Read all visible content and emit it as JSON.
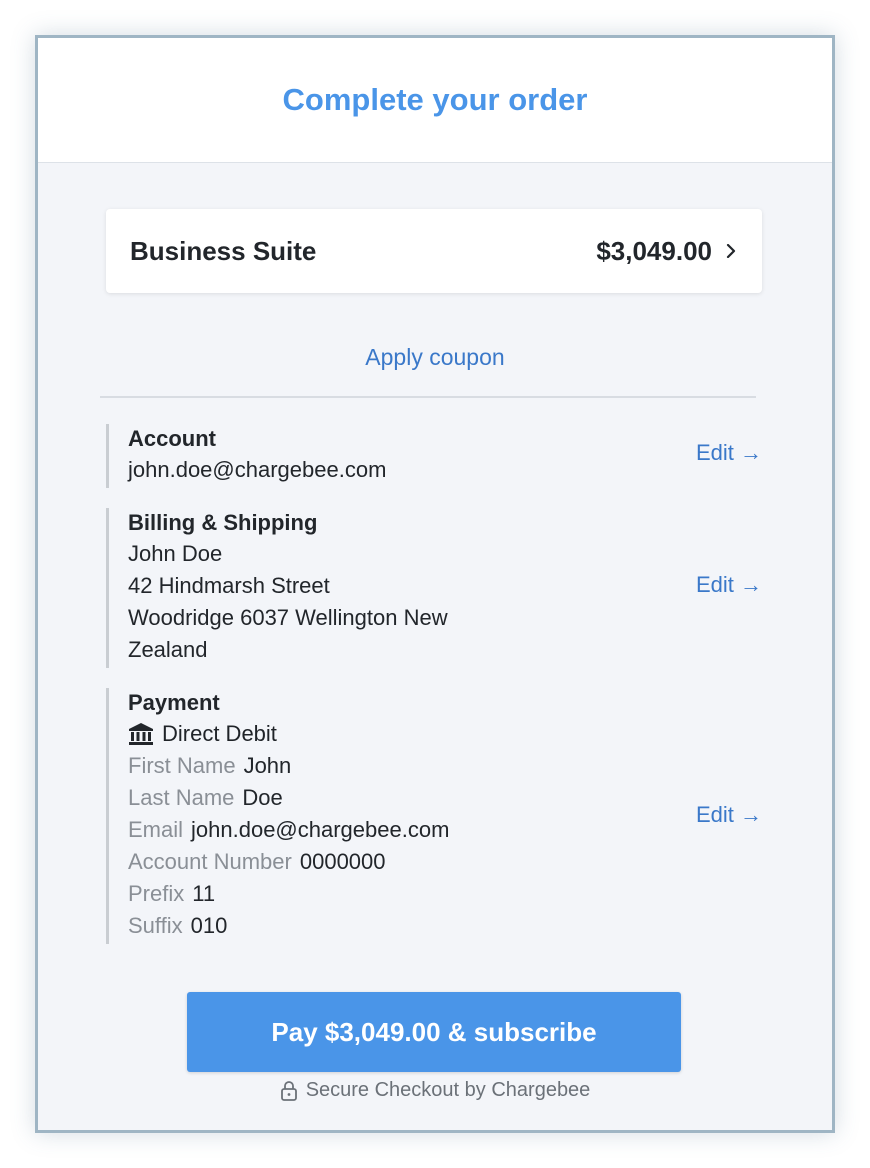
{
  "header": {
    "title": "Complete your order"
  },
  "product": {
    "name": "Business Suite",
    "price": "$3,049.00",
    "icon": "chevron-right-icon"
  },
  "coupon": {
    "label": "Apply coupon"
  },
  "account": {
    "title": "Account",
    "email": "john.doe@chargebee.com",
    "edit_label": "Edit →"
  },
  "billing": {
    "title": "Billing & Shipping",
    "lines": [
      "John Doe",
      "42 Hindmarsh Street",
      "Woodridge 6037 Wellington New",
      "Zealand"
    ],
    "edit_label": "Edit →"
  },
  "payment": {
    "title": "Payment",
    "method": "Direct Debit",
    "method_icon": "bank-icon",
    "fields": [
      {
        "label": "First Name",
        "value": "John"
      },
      {
        "label": "Last Name",
        "value": "Doe"
      },
      {
        "label": "Email",
        "value": "john.doe@chargebee.com"
      },
      {
        "label": "Account Number",
        "value": "0000000"
      },
      {
        "label": "Prefix",
        "value": "11"
      },
      {
        "label": "Suffix",
        "value": "010"
      }
    ],
    "edit_label": "Edit →"
  },
  "pay_button": {
    "label": "Pay $3,049.00 & subscribe"
  },
  "footer": {
    "secure_text": "Secure Checkout by Chargebee",
    "icon": "lock-icon"
  },
  "colors": {
    "accent": "#4a95e8",
    "link": "#3a78c9",
    "background": "#f3f5f9",
    "frame_border": "#9fb5c4"
  }
}
